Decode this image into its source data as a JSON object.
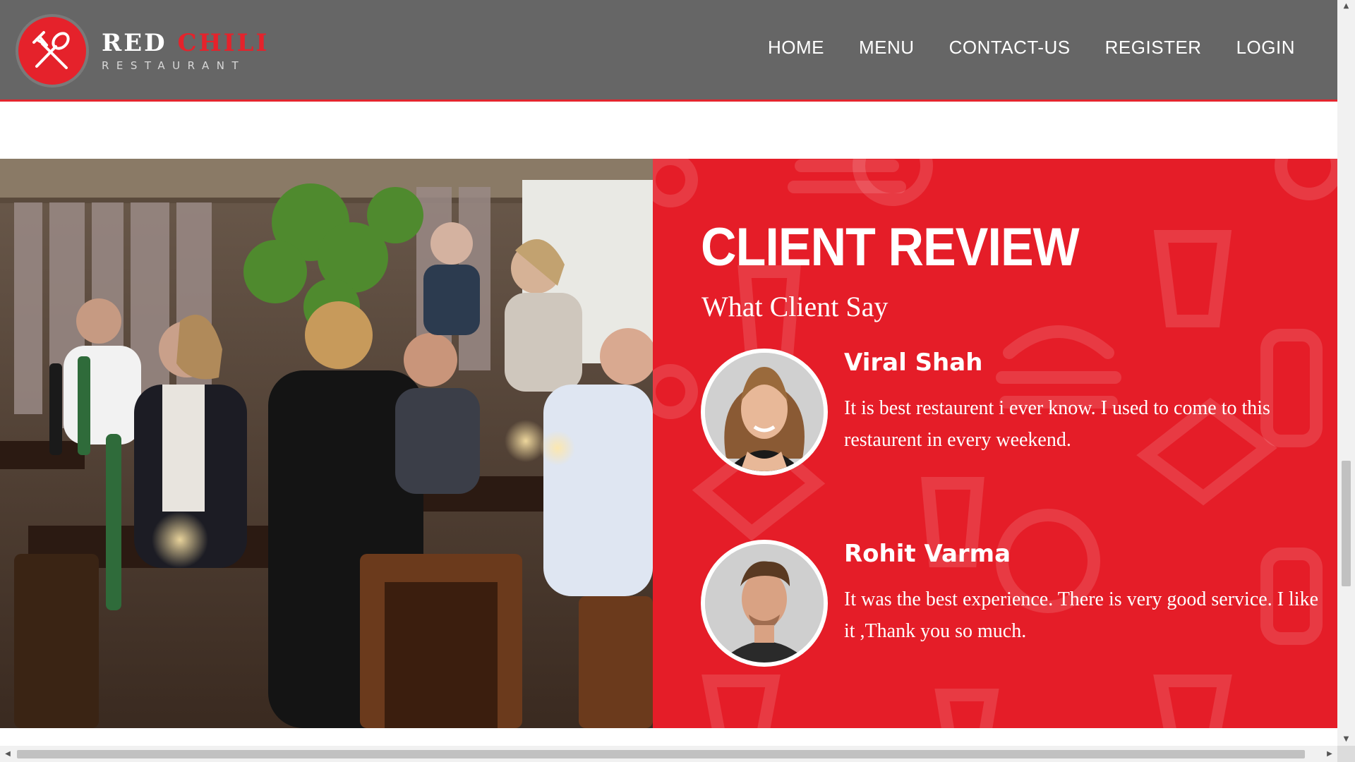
{
  "brand": {
    "name_main": "RED ",
    "name_accent": "CHILI",
    "tagline": "RESTAURANT",
    "logo_icon": "fork-spoon-icon"
  },
  "nav": {
    "items": [
      {
        "label": "HOME"
      },
      {
        "label": "MENU"
      },
      {
        "label": "CONTACT-US"
      },
      {
        "label": "REGISTER"
      },
      {
        "label": "LOGIN"
      }
    ]
  },
  "photo": {
    "subject": "restaurant-dining-photo"
  },
  "reviews": {
    "title": "CLIENT REVIEW",
    "subtitle": "What Client Say",
    "items": [
      {
        "name": "Viral Shah",
        "text": "It is best restaurent i ever know. I used to come to this restaurent in every weekend.",
        "avatar": "female-client-avatar"
      },
      {
        "name": "Rohit Varma",
        "text": "It was the best experience. There is very good service. I like it ,Thank you so much.",
        "avatar": "male-client-avatar"
      }
    ]
  },
  "colors": {
    "header_bg": "#666666",
    "accent_red": "#e51d28",
    "text_white": "#ffffff"
  }
}
